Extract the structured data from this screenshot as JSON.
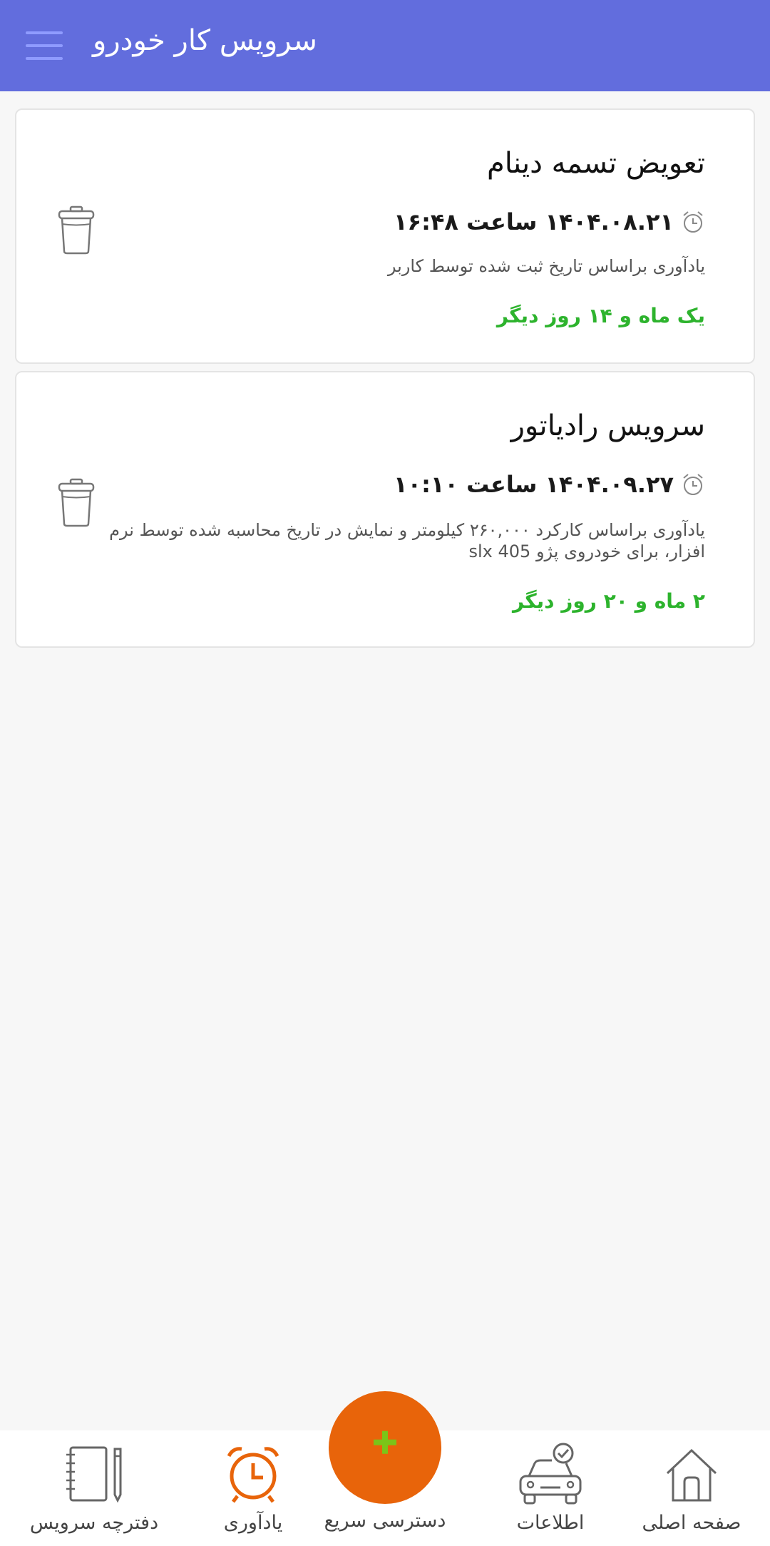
{
  "header": {
    "title": "سرویس کار خودرو",
    "menu_icon": "hamburger-menu-icon"
  },
  "reminders": [
    {
      "title": "تعویض تسمه دینام",
      "datetime": "۱۴۰۴.۰۸.۲۱ ساعت ۱۶:۴۸",
      "description": "یادآوری براساس تاریخ ثبت شده توسط کاربر",
      "due": "یک ماه و ۱۴ روز دیگر"
    },
    {
      "title": "سرویس رادیاتور",
      "datetime": "۱۴۰۴.۰۹.۲۷ ساعت ۱۰:۱۰",
      "description": "یادآوری براساس کارکرد ۲۶۰,۰۰۰ کیلومتر و نمایش در تاریخ محاسبه شده توسط نرم افزار، برای خودروی پژو 405 slx",
      "due": "۲ ماه و ۲۰ روز دیگر"
    }
  ],
  "bottom_nav": {
    "home": "صفحه اصلی",
    "info": "اطلاعات",
    "quick_access": "دسترسی سریع",
    "reminders": "یادآوری",
    "service_book": "دفترچه سرویس"
  },
  "colors": {
    "app_bar": "#626ddd",
    "due_text": "#2db32d",
    "fab": "#e8640a",
    "fab_plus": "#7bc518",
    "active_nav": "#e8640a"
  }
}
